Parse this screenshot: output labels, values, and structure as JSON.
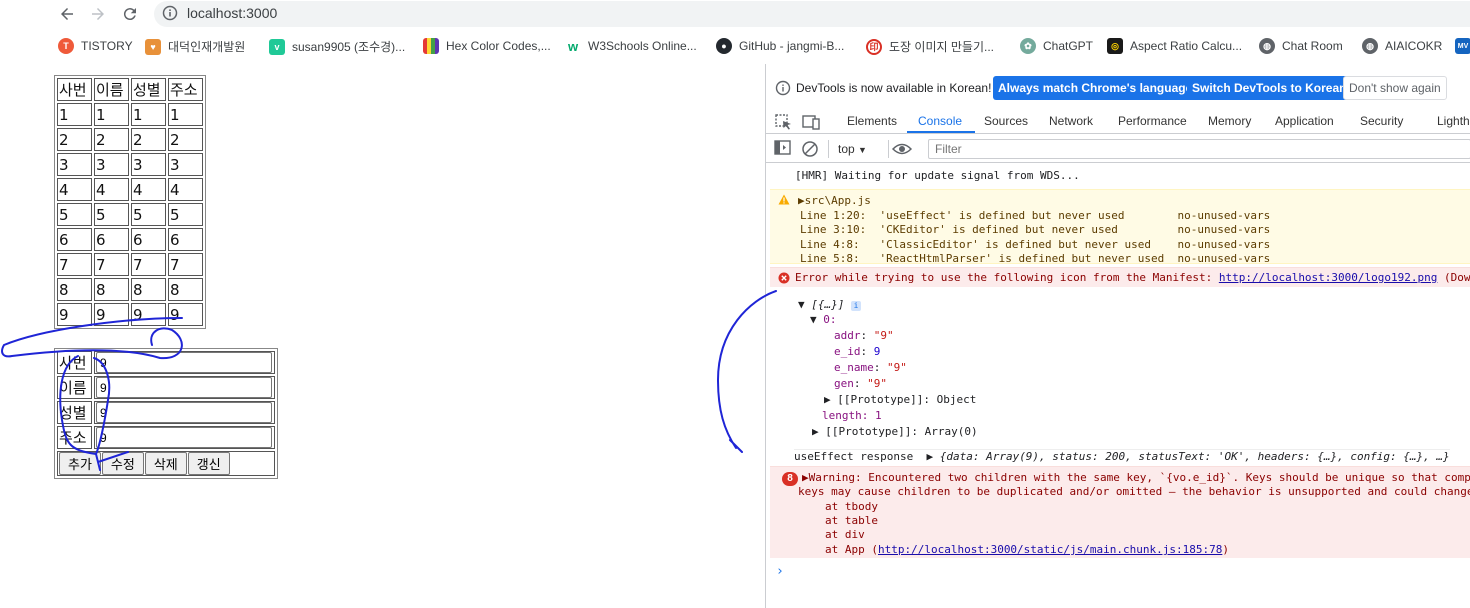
{
  "browser": {
    "url": "localhost:3000",
    "bookmarks": [
      {
        "label": "TISTORY",
        "icon": "tistory-icon",
        "color": "#ef5a3a"
      },
      {
        "label": "대덕인재개발원",
        "icon": "ddit-icon",
        "color": "#e8913a"
      },
      {
        "label": "susan9905 (조수경)...",
        "icon": "velog-icon",
        "color": "#20c997"
      },
      {
        "label": "Hex Color Codes,...",
        "icon": "hex-color-icon",
        "color": "#c83cc8"
      },
      {
        "label": "W3Schools Online...",
        "icon": "w3schools-icon",
        "color": "#04aa6d"
      },
      {
        "label": "GitHub - jangmi-B...",
        "icon": "github-icon",
        "color": "#24292f"
      },
      {
        "label": "도장 이미지 만들기...",
        "icon": "stamp-icon",
        "color": "#d93025"
      },
      {
        "label": "ChatGPT",
        "icon": "chatgpt-icon",
        "color": "#74aa9c"
      },
      {
        "label": "Aspect Ratio Calcu...",
        "icon": "aspect-ratio-icon",
        "color": "#1a1a1a"
      },
      {
        "label": "Chat Room",
        "icon": "globe-icon",
        "color": "#5f6368"
      },
      {
        "label": "AIAICOKR",
        "icon": "globe-icon",
        "color": "#5f6368"
      }
    ]
  },
  "page": {
    "headers": [
      "사번",
      "이름",
      "성별",
      "주소"
    ],
    "rows": [
      [
        "1",
        "1",
        "1",
        "1"
      ],
      [
        "2",
        "2",
        "2",
        "2"
      ],
      [
        "3",
        "3",
        "3",
        "3"
      ],
      [
        "4",
        "4",
        "4",
        "4"
      ],
      [
        "5",
        "5",
        "5",
        "5"
      ],
      [
        "6",
        "6",
        "6",
        "6"
      ],
      [
        "7",
        "7",
        "7",
        "7"
      ],
      [
        "8",
        "8",
        "8",
        "8"
      ],
      [
        "9",
        "9",
        "9",
        "9"
      ]
    ],
    "form": [
      {
        "label": "사번",
        "value": "9"
      },
      {
        "label": "이름",
        "value": "9"
      },
      {
        "label": "성별",
        "value": "9"
      },
      {
        "label": "주소",
        "value": "9"
      }
    ],
    "buttons": {
      "add": "추가",
      "edit": "수정",
      "delete": "삭제",
      "refresh": "갱신"
    }
  },
  "devtools": {
    "notice": {
      "text": "DevTools is now available in Korean!",
      "match": "Always match Chrome's language",
      "switch": "Switch DevTools to Korean",
      "dismiss": "Don't show again"
    },
    "tabs": [
      "Elements",
      "Console",
      "Sources",
      "Network",
      "Performance",
      "Memory",
      "Application",
      "Security",
      "Lighth"
    ],
    "active_tab": "Console",
    "context": "top",
    "filter_placeholder": "Filter",
    "console": {
      "hmr": "[HMR] Waiting for update signal from WDS...",
      "warn_file": "src\\App.js",
      "warn_lines": [
        "Line 1:20:  'useEffect' is defined but never used        no-unused-vars",
        "Line 3:10:  'CKEditor' is defined but never used         no-unused-vars",
        "Line 4:8:   'ClassicEditor' is defined but never used    no-unused-vars",
        "Line 5:8:   'ReactHtmlParser' is defined but never used  no-unused-vars"
      ],
      "error_text": "Error while trying to use the following icon from the Manifest: ",
      "error_link": "http://localhost:3000/logo192.png",
      "error_tail": " (Down",
      "obj_header": "[{…}]",
      "obj_index": "0:",
      "props": [
        {
          "key": "addr",
          "value": "\"9\"",
          "type": "string"
        },
        {
          "key": "e_id",
          "value": "9",
          "type": "number"
        },
        {
          "key": "e_name",
          "value": "\"9\"",
          "type": "string"
        },
        {
          "key": "gen",
          "value": "\"9\"",
          "type": "string"
        }
      ],
      "proto_obj": "[[Prototype]]: Object",
      "length": "length: 1",
      "proto_arr": "[[Prototype]]: Array(0)",
      "response_label": "useEffect response",
      "response_obj": "{data: Array(9), status: 200, statusText: 'OK', headers: {…}, config: {…}, …}",
      "warning_count": "8",
      "warning_line1": "Warning: Encountered two children with the same key, `{vo.e_id}`. Keys should be unique so that comp",
      "warning_line2": "keys may cause children to be duplicated and/or omitted — the behavior is unsupported and could change",
      "stack": [
        "at tbody",
        "at table",
        "at div"
      ],
      "stack_app": "at App (",
      "stack_link": "http://localhost:3000/static/js/main.chunk.js:185:78",
      "stack_close": ")"
    }
  },
  "colors": {
    "accent": "#1a73e8",
    "annotation": "#1f25d6",
    "warn_bg": "#fffbe5",
    "error_bg": "#fcebeb"
  }
}
